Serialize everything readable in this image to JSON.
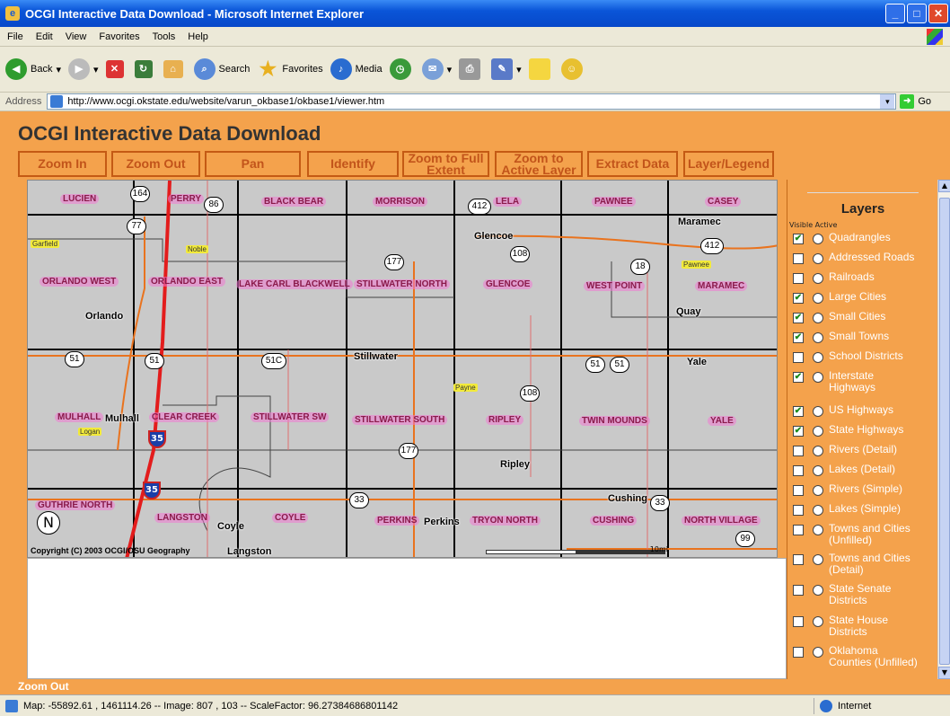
{
  "window": {
    "title": "OCGI Interactive Data Download - Microsoft Internet Explorer"
  },
  "menu": [
    "File",
    "Edit",
    "View",
    "Favorites",
    "Tools",
    "Help"
  ],
  "toolbar": {
    "back": "Back",
    "search": "Search",
    "favorites": "Favorites",
    "media": "Media"
  },
  "address": {
    "label": "Address",
    "url": "http://www.ocgi.okstate.edu/website/varun_okbase1/okbase1/viewer.htm",
    "go": "Go"
  },
  "app": {
    "title": "OCGI Interactive Data Download",
    "tools": [
      {
        "label": "Zoom In"
      },
      {
        "label": "Zoom Out"
      },
      {
        "label": "Pan"
      },
      {
        "label": "Identify"
      },
      {
        "label": "Zoom to Full Extent"
      },
      {
        "label": "Zoom to Active Layer"
      },
      {
        "label": "Extract Data"
      },
      {
        "label": "Layer/Legend"
      }
    ]
  },
  "map": {
    "quadrangles": [
      "LUCIEN",
      "PERRY",
      "BLACK BEAR",
      "MORRISON",
      "LELA",
      "PAWNEE",
      "CASEY",
      "ORLANDO WEST",
      "ORLANDO EAST",
      "LAKE CARL BLACKWELL",
      "STILLWATER NORTH",
      "GLENCOE",
      "WEST POINT",
      "MARAMEC",
      "MULHALL",
      "CLEAR CREEK",
      "STILLWATER SW",
      "STILLWATER SOUTH",
      "RIPLEY",
      "TWIN MOUNDS",
      "YALE",
      "GUTHRIE NORTH",
      "LANGSTON",
      "COYLE",
      "PERKINS",
      "TRYON NORTH",
      "CUSHING",
      "NORTH VILLAGE"
    ],
    "cities": [
      "Maramec",
      "Glencoe",
      "Orlando",
      "Quay",
      "Stillwater",
      "Yale",
      "Mulhall",
      "Ripley",
      "Cushing",
      "Coyle",
      "Perkins",
      "Langston"
    ],
    "counties": [
      "Garfield",
      "Noble",
      "Pawnee",
      "Payne",
      "Logan"
    ],
    "highways": [
      "164",
      "86",
      "77",
      "412",
      "108",
      "177",
      "18",
      "412",
      "51",
      "51",
      "51C",
      "51",
      "51",
      "108",
      "177",
      "33",
      "33",
      "99"
    ],
    "interstates": [
      "35",
      "35"
    ],
    "north": "N",
    "copyright": "Copyright (C) 2003 OCGI/OSU Geography",
    "scale_label": "10mi"
  },
  "layers": {
    "title": "Layers",
    "visible_active_label": "Visible Active",
    "items": [
      {
        "label": "Quadrangles",
        "visible": true
      },
      {
        "label": "Addressed Roads",
        "visible": false
      },
      {
        "label": "Railroads",
        "visible": false
      },
      {
        "label": "Large Cities",
        "visible": true
      },
      {
        "label": "Small Cities",
        "visible": true
      },
      {
        "label": "Small Towns",
        "visible": true
      },
      {
        "label": "School Districts",
        "visible": false
      },
      {
        "label": "Interstate Highways",
        "visible": true
      },
      {
        "label": "US Highways",
        "visible": true
      },
      {
        "label": "State Highways",
        "visible": true
      },
      {
        "label": "Rivers (Detail)",
        "visible": false
      },
      {
        "label": "Lakes (Detail)",
        "visible": false
      },
      {
        "label": "Rivers (Simple)",
        "visible": false
      },
      {
        "label": "Lakes (Simple)",
        "visible": false
      },
      {
        "label": "Towns and Cities (Unfilled)",
        "visible": false
      },
      {
        "label": "Towns and Cities (Detail)",
        "visible": false
      },
      {
        "label": "State Senate Districts",
        "visible": false
      },
      {
        "label": "State House Districts",
        "visible": false
      },
      {
        "label": "Oklahoma Counties (Unfilled)",
        "visible": false
      }
    ]
  },
  "mode_status": "Zoom Out",
  "statusbar": {
    "text": "Map: -55892.61 , 1461114.26 -- Image: 807 , 103 -- ScaleFactor: 96.27384686801142",
    "zone": "Internet"
  },
  "colors": {
    "page_bg": "#f4a24c",
    "map_bg": "#c9c9c9",
    "quad_label": "#f078d2",
    "tool_text": "#c2541a"
  }
}
